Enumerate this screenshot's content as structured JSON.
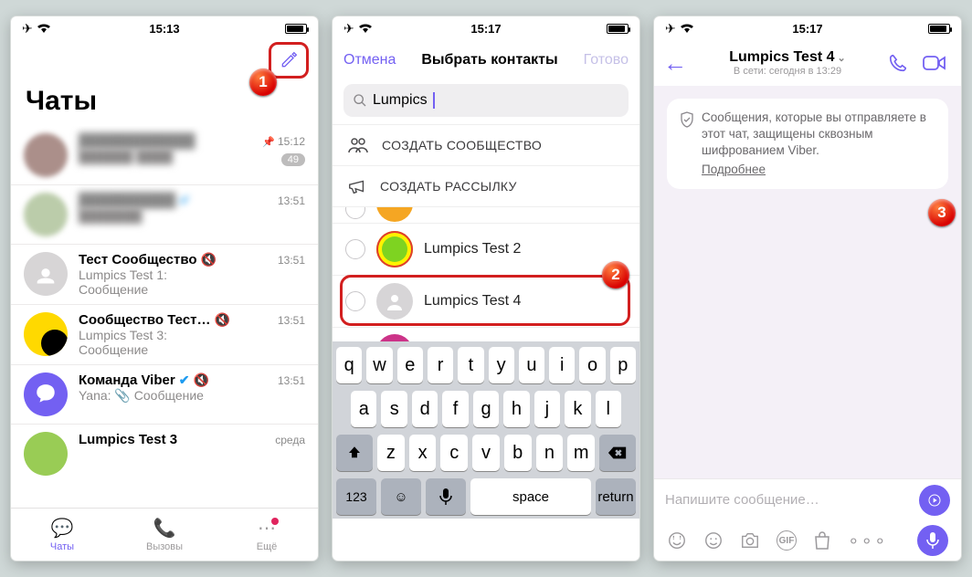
{
  "status": {
    "time1": "15:13",
    "time2": "15:17",
    "time3": "15:17"
  },
  "screen1": {
    "title": "Чаты",
    "rows": [
      {
        "name": "████████████",
        "sub": "██████ ████",
        "time": "15:12",
        "badge": "49",
        "blurred": true
      },
      {
        "name": "██████████",
        "sub": "███████",
        "time": "13:51",
        "verified": true,
        "blurred": true
      },
      {
        "name": "Тест Сообщество",
        "sub": "Lumpics Test 1:",
        "sub2": "Сообщение",
        "time": "13:51",
        "muted": true,
        "ava": "gray"
      },
      {
        "name": "Сообщество Тест…",
        "sub": "Lumpics Test 3:",
        "sub2": "Сообщение",
        "time": "13:51",
        "muted": true,
        "ava": "yb"
      },
      {
        "name": "Команда Viber",
        "sub": "Yana: 📎 Сообщение",
        "time": "13:51",
        "verified": true,
        "muted": true,
        "ava": "purple"
      },
      {
        "name": "Lumpics Test 3",
        "time": "среда",
        "partial": true
      }
    ],
    "tabs": {
      "chats": "Чаты",
      "calls": "Вызовы",
      "more": "Ещё"
    }
  },
  "screen2": {
    "cancel": "Отмена",
    "title": "Выбрать контакты",
    "done": "Готово",
    "search": "Lumpics",
    "opt_community": "СОЗДАТЬ СООБЩЕСТВО",
    "opt_broadcast": "СОЗДАТЬ РАССЫЛКУ",
    "contacts": [
      {
        "name": "Lumpics Test 2",
        "ava": "lime"
      },
      {
        "name": "Lumpics Test 4",
        "ava": "gray",
        "selected": true
      }
    ],
    "keys": {
      "r1": [
        "q",
        "w",
        "e",
        "r",
        "t",
        "y",
        "u",
        "i",
        "o",
        "p"
      ],
      "r2": [
        "a",
        "s",
        "d",
        "f",
        "g",
        "h",
        "j",
        "k",
        "l"
      ],
      "r3": [
        "z",
        "x",
        "c",
        "v",
        "b",
        "n",
        "m"
      ],
      "num": "123",
      "space": "space",
      "return": "return"
    }
  },
  "screen3": {
    "title": "Lumpics Test 4",
    "sub": "В сети: сегодня в 13:29",
    "notice": "Сообщения, которые вы отправляете в этот чат, защищены сквозным шифрованием Viber.",
    "notice_more": "Подробнее",
    "placeholder": "Напишите сообщение…"
  },
  "markers": {
    "m1": "1",
    "m2": "2",
    "m3": "3"
  }
}
